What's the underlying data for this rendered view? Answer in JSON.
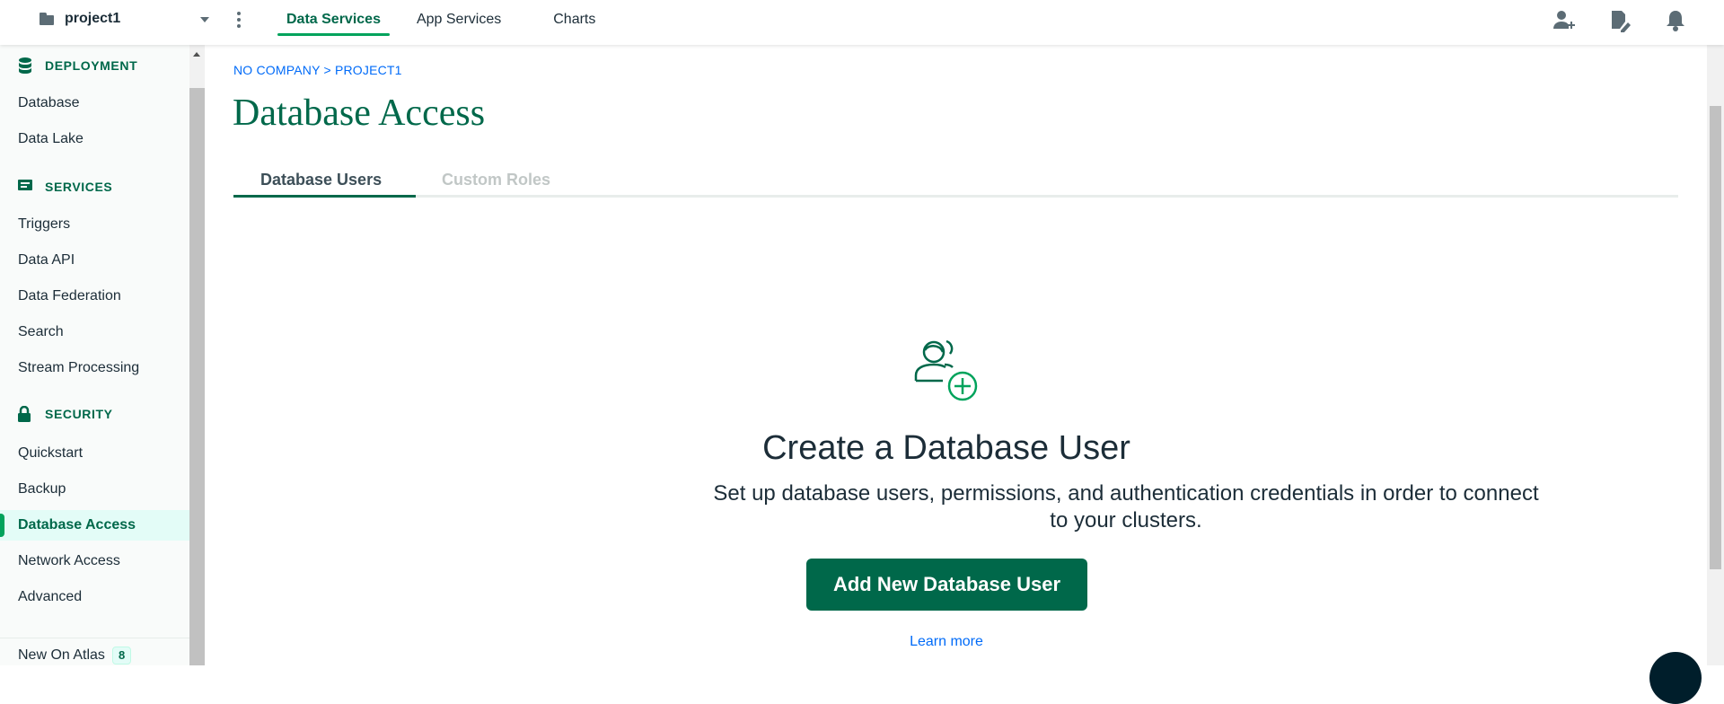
{
  "topbar": {
    "project_name": "project1",
    "tabs": [
      {
        "label": "Data Services",
        "active": true
      },
      {
        "label": "App Services",
        "active": false
      },
      {
        "label": "Charts",
        "active": false
      }
    ],
    "icons": [
      "add-user-icon",
      "edit-document-icon",
      "bell-icon"
    ]
  },
  "sidebar": {
    "sections": [
      {
        "label": "DEPLOYMENT",
        "icon": "database-icon",
        "items": [
          "Database",
          "Data Lake"
        ]
      },
      {
        "label": "SERVICES",
        "icon": "services-icon",
        "items": [
          "Triggers",
          "Data API",
          "Data Federation",
          "Search",
          "Stream Processing"
        ]
      },
      {
        "label": "SECURITY",
        "icon": "lock-icon",
        "items": [
          "Quickstart",
          "Backup",
          "Database Access",
          "Network Access",
          "Advanced"
        ]
      }
    ],
    "active_item": "Database Access",
    "new_on_atlas": {
      "label": "New On Atlas",
      "count": "8"
    }
  },
  "main": {
    "breadcrumb": "NO COMPANY > PROJECT1",
    "title": "Database Access",
    "tabs": [
      {
        "label": "Database Users",
        "active": true
      },
      {
        "label": "Custom Roles",
        "active": false
      }
    ],
    "empty_state": {
      "icon": "add-database-user-icon",
      "heading": "Create a Database User",
      "description": "Set up database users, permissions, and authentication credentials in order to connect to your clusters.",
      "button": "Add New Database User",
      "link": "Learn more"
    }
  },
  "colors": {
    "brand_green": "#00684a",
    "accent_green": "#00a35c",
    "link_blue": "#016bf8"
  }
}
